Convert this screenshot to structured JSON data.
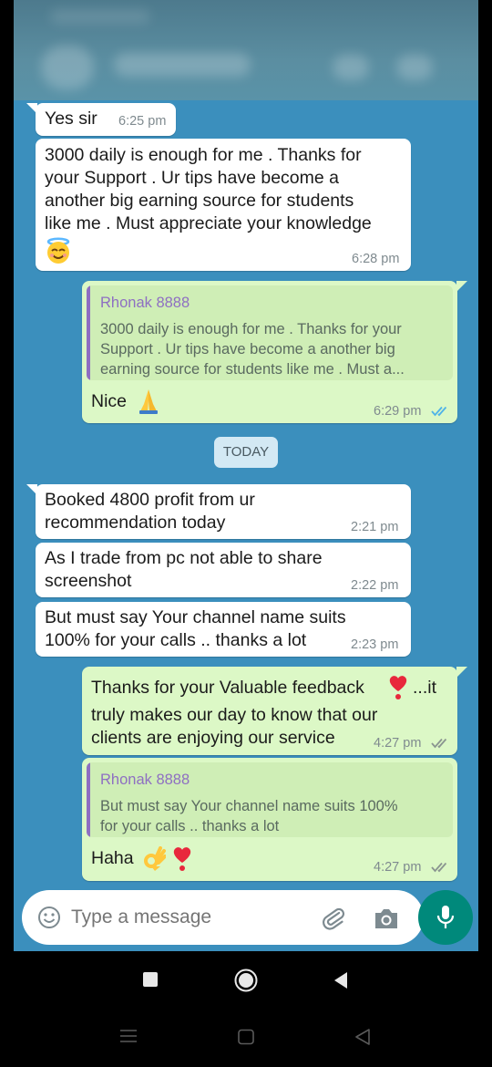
{
  "messages": [
    {
      "dir": "in",
      "text": "Yes sir",
      "time": "6:25 pm"
    },
    {
      "dir": "in",
      "text": "3000 daily is enough for me . Thanks for\nyour Support . Ur tips have become a\nanother big earning source for students\nlike me . Must appreciate your knowledge",
      "time": "6:28 pm"
    },
    {
      "dir": "out",
      "quote_name": "Rhonak 8888",
      "quote_text": "3000 daily is enough for me . Thanks for your\nSupport . Ur tips have become a another big\nearning source for students like me . Must a...",
      "text": "Nice",
      "time": "6:29 pm",
      "status": "read"
    },
    {
      "dir": "in",
      "text": "Booked 4800 profit from ur\nrecommendation today",
      "time": "2:21 pm"
    },
    {
      "dir": "in",
      "text": "As I trade from pc not able to share\nscreenshot",
      "time": "2:22 pm"
    },
    {
      "dir": "in",
      "text": "But must say Your channel name suits\n100% for your calls .. thanks a lot",
      "time": "2:23 pm"
    },
    {
      "dir": "out",
      "text_line1": "Thanks for your Valuable feedback",
      "text_line1b": "...it",
      "text_rest": "truly makes our day to know that our\nclients are enjoying our service",
      "time": "4:27 pm",
      "status": "delivered"
    },
    {
      "dir": "out",
      "quote_name": "Rhonak 8888",
      "quote_text": "But must say Your channel name suits 100%\nfor your calls .. thanks a lot",
      "text": "Haha",
      "time": "4:27 pm",
      "status": "delivered"
    }
  ],
  "date_divider": "TODAY",
  "composer": {
    "placeholder": "Type a message"
  },
  "colors": {
    "chat_bg": "#3b8fbd",
    "outgoing": "#dcf8c6",
    "incoming": "#ffffff",
    "accent": "#00897b",
    "quote_name": "#8e6fc2",
    "read_ticks": "#4fb3e8"
  }
}
